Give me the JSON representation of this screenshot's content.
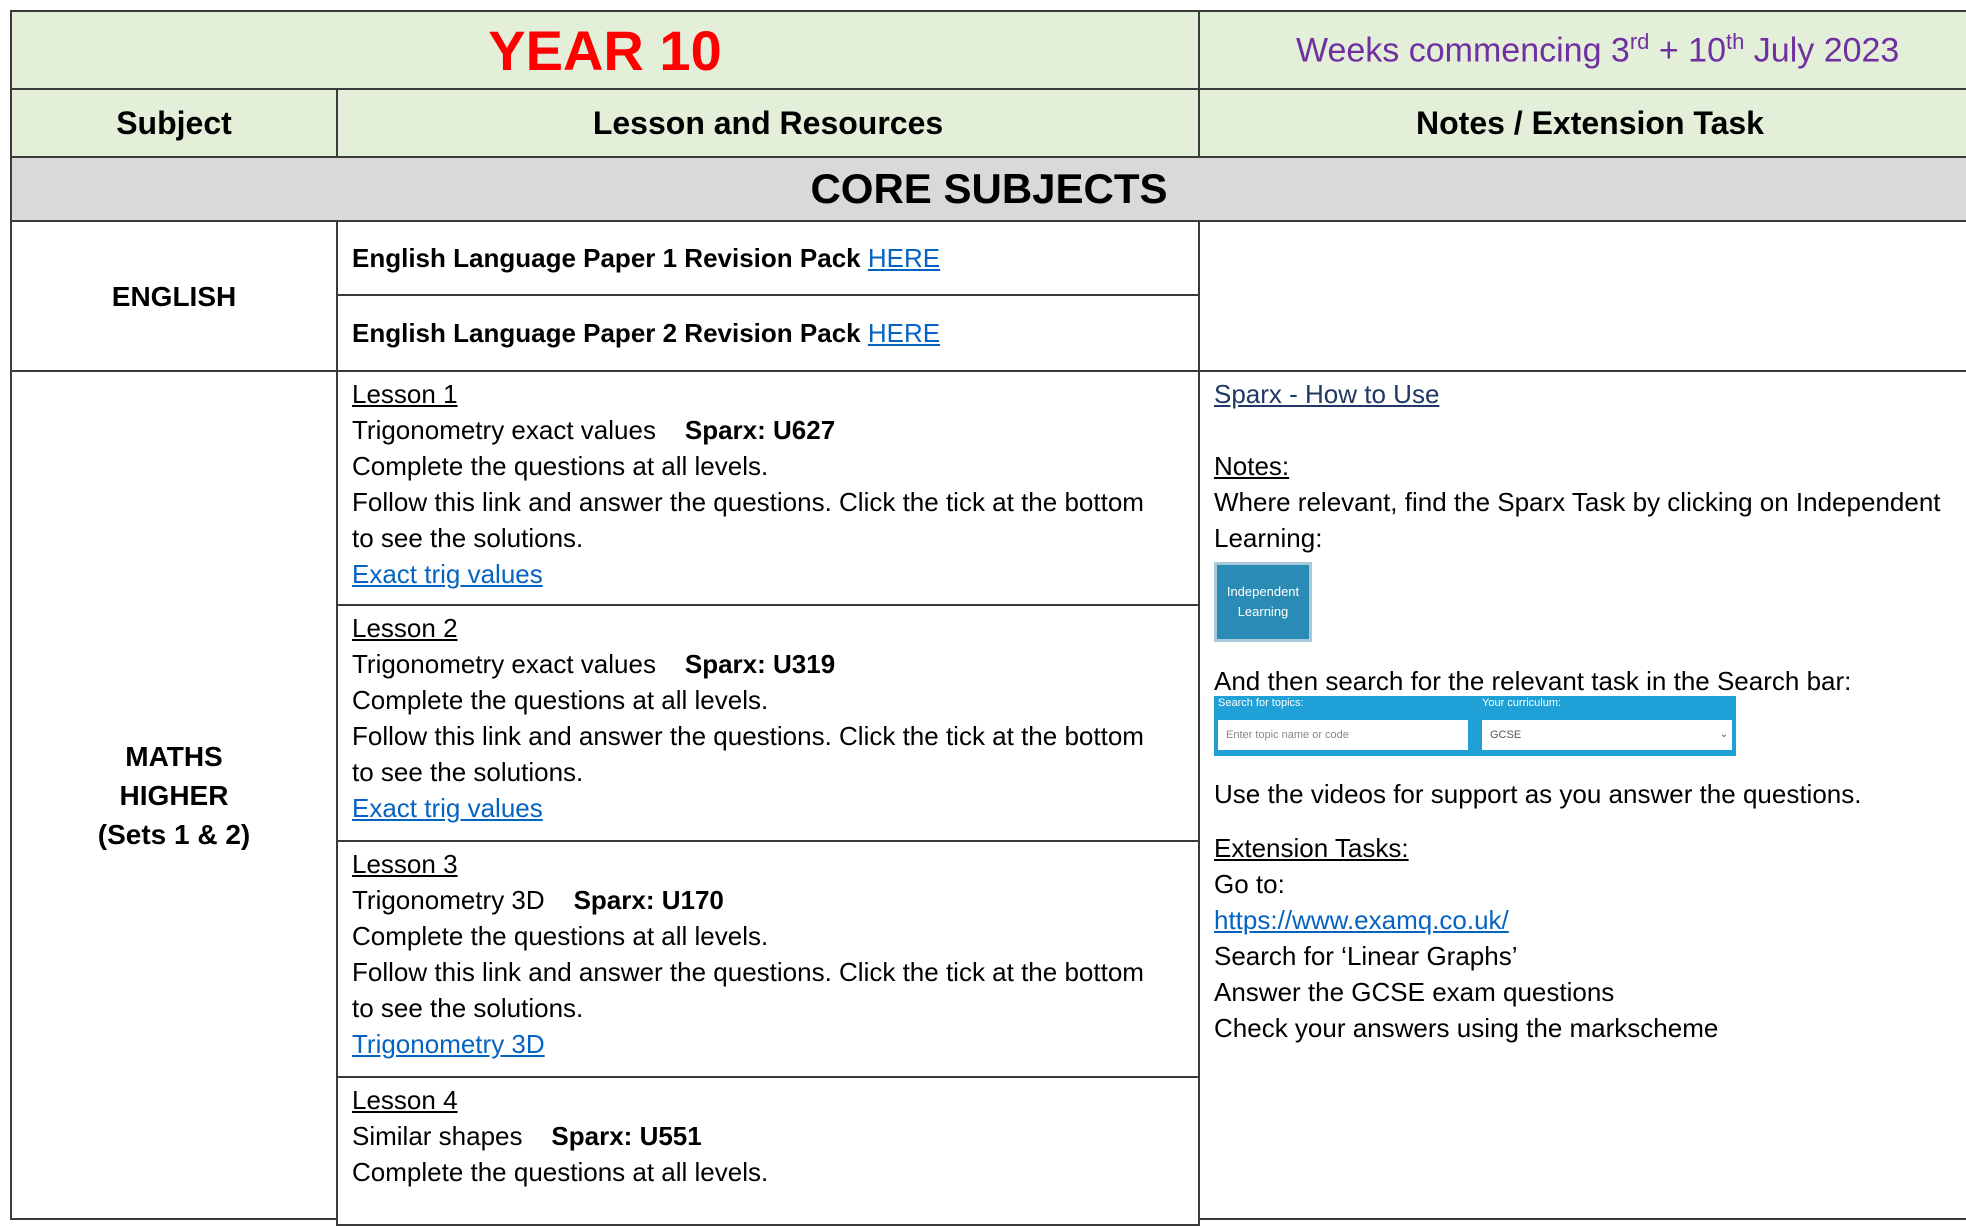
{
  "header": {
    "year": "YEAR 10",
    "weeks_prefix": "Weeks commencing 3",
    "weeks_sup1": "rd",
    "weeks_mid": " + 10",
    "weeks_sup2": "th",
    "weeks_suffix": " July 2023"
  },
  "columns": {
    "subject": "Subject",
    "lesson": "Lesson and Resources",
    "notes": "Notes / Extension Task"
  },
  "section": "CORE SUBJECTS",
  "english": {
    "subject": "ENGLISH",
    "row1_text": "English Language Paper 1 Revision Pack",
    "row1_link": "HERE",
    "row2_text": "English Language Paper 2 Revision Pack",
    "row2_link": "HERE"
  },
  "maths": {
    "subject_line1": "MATHS",
    "subject_line2": "HIGHER",
    "subject_line3": "(Sets 1 & 2)",
    "lessons": [
      {
        "title": "Lesson 1",
        "topic": "Trigonometry exact values",
        "sparx": "Sparx: U627",
        "line2": "Complete the questions at all levels.",
        "line3": "Follow this link and answer the questions. Click the tick at the bottom",
        "line4": "to see the solutions.",
        "link": "Exact trig values"
      },
      {
        "title": "Lesson 2",
        "topic": "Trigonometry exact values",
        "sparx": "Sparx: U319",
        "line2": "Complete the questions at all levels.",
        "line3": "Follow this link and answer the questions. Click the tick at the bottom",
        "line4": "to see the solutions.",
        "link": "Exact trig values"
      },
      {
        "title": "Lesson 3",
        "topic": "Trigonometry 3D",
        "sparx": "Sparx: U170",
        "line2": "Complete the questions at all levels.",
        "line3": "Follow this link and answer the questions. Click the tick at the bottom",
        "line4": "to see the solutions.",
        "link": "Trigonometry 3D"
      },
      {
        "title": "Lesson 4",
        "topic": "Similar shapes",
        "sparx": "Sparx: U551",
        "line2": "Complete the questions at all levels."
      }
    ]
  },
  "notes": {
    "sparx_link": "Sparx - How to Use",
    "notes_heading": "Notes:",
    "notes_line1": "Where relevant, find the Sparx Task by clicking on Independent",
    "notes_line2": "Learning:",
    "il_button_line1": "Independent",
    "il_button_line2": "Learning",
    "search_instruction": "And then search for the relevant task in the Search bar:",
    "search_topics_label": "Search for topics:",
    "search_placeholder": "Enter topic name or code",
    "curriculum_label": "Your curriculum:",
    "curriculum_value": "GCSE",
    "videos_line": "Use the videos for support as you answer the questions.",
    "extension_heading": "Extension Tasks:",
    "goto": "Go to:",
    "examq_link": "https://www.examq.co.uk/",
    "search_for": "Search for ‘Linear Graphs’",
    "answer": "Answer the GCSE exam questions",
    "check": "Check your answers using the markscheme"
  },
  "colors": {
    "header_bg": "#e3efd9",
    "section_bg": "#d9d9d9",
    "year_red": "#ff0000",
    "weeks_purple": "#7030a0",
    "link_blue": "#0563c1",
    "sparx_blue": "#1a8bb8"
  }
}
